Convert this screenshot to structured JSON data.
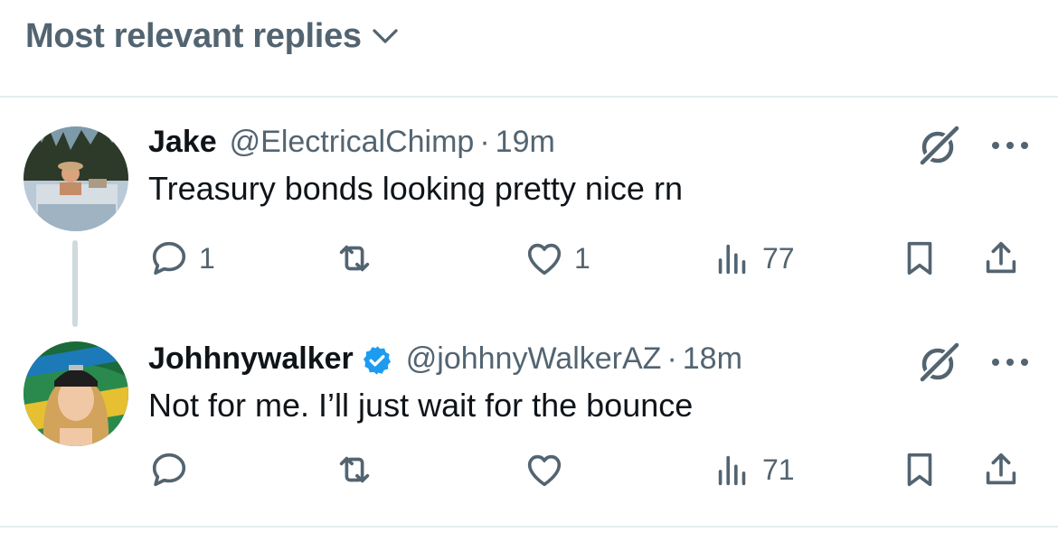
{
  "sort": {
    "label": "Most relevant replies"
  },
  "tweets": [
    {
      "name": "Jake",
      "handle": "@ElectricalChimp",
      "separator": "·",
      "time": "19m",
      "text": "Treasury bonds looking pretty nice rn",
      "verified": false,
      "stats": {
        "replies": "1",
        "retweets": "",
        "likes": "1",
        "views": "77"
      }
    },
    {
      "name": "Johhnywalker",
      "handle": "@johhnyWalkerAZ",
      "separator": "·",
      "time": "18m",
      "text": "Not for me. I’ll just wait for the bounce",
      "verified": true,
      "stats": {
        "replies": "",
        "retweets": "",
        "likes": "",
        "views": "71"
      }
    }
  ],
  "colors": {
    "text": "#0f1419",
    "secondary": "#536471",
    "verified": "#1d9bf0",
    "divider": "#e6ecf0"
  },
  "icons": [
    "chevron-down-icon",
    "grok-icon",
    "more-icon",
    "reply-icon",
    "retweet-icon",
    "like-icon",
    "views-icon",
    "bookmark-icon",
    "share-icon",
    "verified-badge-icon"
  ]
}
